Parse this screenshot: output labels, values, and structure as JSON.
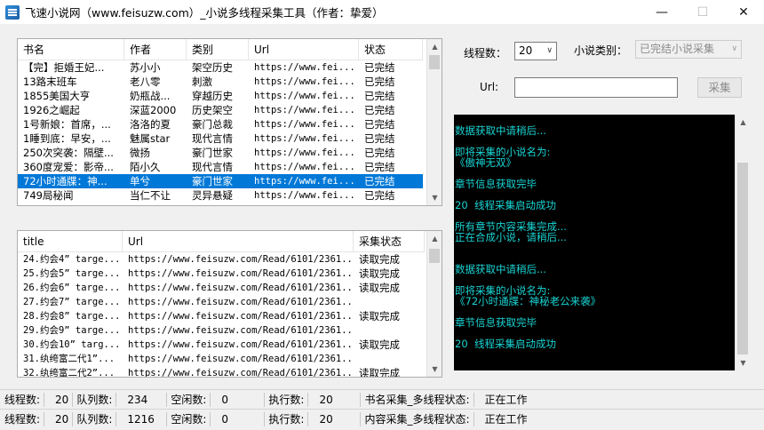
{
  "window": {
    "title": "飞速小说网（www.feisuzw.com）_小说多线程采集工具（作者：挚爱）",
    "min_glyph": "—",
    "max_glyph": "☐",
    "close_glyph": "✕"
  },
  "novel_list": {
    "columns": [
      "书名",
      "作者",
      "类别",
      "Url",
      "状态"
    ],
    "rows": [
      [
        "【完】拒婚王妃...",
        "苏小小",
        "架空历史",
        "https://www.fei...",
        "已完结"
      ],
      [
        "13路末班车",
        "老八零",
        "刺激",
        "https://www.fei...",
        "已完结"
      ],
      [
        "1855美国大亨",
        "奶瓶战...",
        "穿越历史",
        "https://www.fei...",
        "已完结"
      ],
      [
        "1926之崛起",
        "深蓝2000",
        "历史架空",
        "https://www.fei...",
        "已完结"
      ],
      [
        "1号新娘：首席，...",
        "洛洛的夏",
        "豪门总裁",
        "https://www.fei...",
        "已完结"
      ],
      [
        "1睡到底：早安，...",
        "魅属star",
        "现代言情",
        "https://www.fei...",
        "已完结"
      ],
      [
        "250次突袭：隔壁...",
        "微扬",
        "豪门世家",
        "https://www.fei...",
        "已完结"
      ],
      [
        "360度宠爱：影帝...",
        "陌小久",
        "现代言情",
        "https://www.fei...",
        "已完结"
      ],
      [
        "72小时通牒：神...",
        "单兮",
        "豪门世家",
        "https://www.fei...",
        "已完结"
      ],
      [
        "749局秘闻",
        "当仁不让",
        "灵异悬疑",
        "https://www.fei...",
        "已完结"
      ]
    ],
    "selected_row_index": 8
  },
  "chapter_list": {
    "columns": [
      "title",
      "Url",
      "采集状态"
    ],
    "rows": [
      [
        "24.约会4” targe...",
        "https://www.feisuzw.com/Read/6101/2361...",
        "读取完成"
      ],
      [
        "25.约会5” targe...",
        "https://www.feisuzw.com/Read/6101/2361...",
        "读取完成"
      ],
      [
        "26.约会6” targe...",
        "https://www.feisuzw.com/Read/6101/2361...",
        "读取完成"
      ],
      [
        "27.约会7” targe...",
        "https://www.feisuzw.com/Read/6101/2361...",
        ""
      ],
      [
        "28.约会8” targe...",
        "https://www.feisuzw.com/Read/6101/2361...",
        "读取完成"
      ],
      [
        "29.约会9” targe...",
        "https://www.feisuzw.com/Read/6101/2361...",
        ""
      ],
      [
        "30.约会10” targ...",
        "https://www.feisuzw.com/Read/6101/2361...",
        "读取完成"
      ],
      [
        "31.纨绔富二代1”...",
        "https://www.feisuzw.com/Read/6101/2361...",
        ""
      ],
      [
        "32.纨绔富二代2”...",
        "https://www.feisuzw.com/Read/6101/2361...",
        "读取完成"
      ]
    ]
  },
  "controls": {
    "thread_count_label": "线程数：",
    "thread_count_value": "20",
    "category_label": "小说类别：",
    "category_value": "已完结小说采集",
    "url_label": "Url:",
    "url_value": "",
    "collect_button": "采集"
  },
  "console": {
    "lines": [
      "",
      "数据获取中请稍后...",
      "",
      "即将采集的小说名为:",
      "《傲神无双》",
      "",
      "章节信息获取完毕",
      "",
      "20  线程采集启动成功",
      "",
      "所有章节内容采集完成...",
      "正在合成小说，请稍后...",
      "",
      "",
      "数据获取中请稍后...",
      "",
      "即将采集的小说名为:",
      "《72小时通牒：神秘老公来袭》",
      "",
      "章节信息获取完毕",
      "",
      "20  线程采集启动成功"
    ],
    "text_color": "#19d4d4"
  },
  "status_rows": [
    {
      "threads_label": "线程数:",
      "threads_value": "20",
      "queue_label": "队列数:",
      "queue_value": "234",
      "idle_label": "空闲数:",
      "idle_value": "0",
      "exec_label": "执行数:",
      "exec_value": "20",
      "state_label": "书名采集_多线程状态:",
      "state_value": "正在工作"
    },
    {
      "threads_label": "线程数:",
      "threads_value": "20",
      "queue_label": "队列数:",
      "queue_value": "1216",
      "idle_label": "空闲数:",
      "idle_value": "0",
      "exec_label": "执行数:",
      "exec_value": "20",
      "state_label": "内容采集_多线程状态:",
      "state_value": "正在工作"
    }
  ],
  "colors": {
    "selection": "#0078d7",
    "console_bg": "#000000"
  }
}
